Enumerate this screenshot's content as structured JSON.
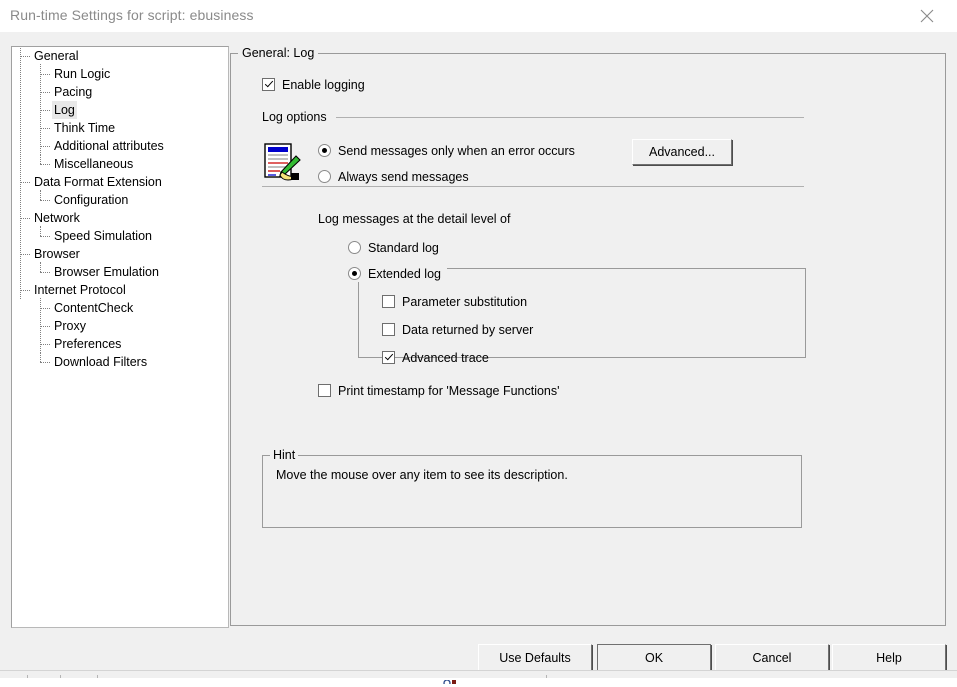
{
  "window": {
    "title": "Run-time Settings for script: ebusiness",
    "close_icon": "close-x-icon"
  },
  "tree": {
    "nodes": [
      {
        "label": "General",
        "level": 0,
        "selected": false
      },
      {
        "label": "Run Logic",
        "level": 1,
        "selected": false
      },
      {
        "label": "Pacing",
        "level": 1,
        "selected": false
      },
      {
        "label": "Log",
        "level": 1,
        "selected": true
      },
      {
        "label": "Think Time",
        "level": 1,
        "selected": false
      },
      {
        "label": "Additional attributes",
        "level": 1,
        "selected": false
      },
      {
        "label": "Miscellaneous",
        "level": 1,
        "selected": false,
        "last_child": true
      },
      {
        "label": "Data Format Extension",
        "level": 0,
        "selected": false
      },
      {
        "label": "Configuration",
        "level": 1,
        "selected": false,
        "last_child": true
      },
      {
        "label": "Network",
        "level": 0,
        "selected": false
      },
      {
        "label": "Speed Simulation",
        "level": 1,
        "selected": false,
        "last_child": true
      },
      {
        "label": "Browser",
        "level": 0,
        "selected": false
      },
      {
        "label": "Browser Emulation",
        "level": 1,
        "selected": false,
        "last_child": true
      },
      {
        "label": "Internet Protocol",
        "level": 0,
        "selected": false,
        "last_root": true
      },
      {
        "label": "ContentCheck",
        "level": 1,
        "selected": false,
        "no_trunk": true
      },
      {
        "label": "Proxy",
        "level": 1,
        "selected": false,
        "no_trunk": true
      },
      {
        "label": "Preferences",
        "level": 1,
        "selected": false,
        "no_trunk": true
      },
      {
        "label": "Download Filters",
        "level": 1,
        "selected": false,
        "no_trunk": true,
        "last_child": true
      }
    ]
  },
  "content": {
    "group_title": "General: Log",
    "enable_logging": {
      "label": "Enable logging",
      "checked": true
    },
    "log_options": {
      "group_title": "Log options",
      "icon": "log-document-pencil-icon",
      "radios": [
        {
          "label": "Send messages only when an error occurs",
          "checked": true
        },
        {
          "label": "Always send messages",
          "checked": false
        }
      ],
      "advanced_button": "Advanced..."
    },
    "detail_level": {
      "heading": "Log messages at the detail level of",
      "radios": [
        {
          "label": "Standard log",
          "checked": false
        },
        {
          "label": "Extended log",
          "checked": true
        }
      ],
      "extended_options": [
        {
          "label": "Parameter substitution",
          "checked": false
        },
        {
          "label": "Data returned by server",
          "checked": false
        },
        {
          "label": "Advanced trace",
          "checked": true
        }
      ]
    },
    "print_timestamp": {
      "label": "Print timestamp for 'Message Functions'",
      "checked": false
    },
    "hint": {
      "title": "Hint",
      "text": "Move the mouse over any item to see its description."
    }
  },
  "buttons": {
    "use_defaults": "Use Defaults",
    "ok": "OK",
    "cancel": "Cancel",
    "help": "Help"
  },
  "colors": {
    "dialog_bg": "#f0f0f0",
    "panel_bg": "#ffffff",
    "border": "#9a9a9a",
    "title_text": "#8a8a8a",
    "selection_bg": "#e8e8e8"
  }
}
